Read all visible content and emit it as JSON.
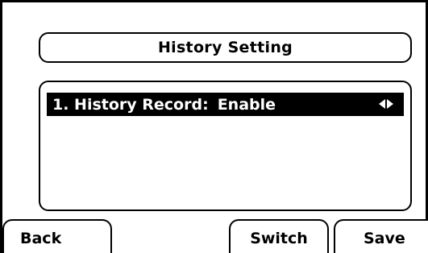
{
  "title": "History Setting",
  "list": {
    "items": [
      {
        "label": "1. History Record:",
        "value": "Enable"
      }
    ]
  },
  "softkeys": {
    "back": "Back",
    "switch": "Switch",
    "save": "Save"
  },
  "colors": {
    "background": "#ffffff",
    "foreground": "#000000",
    "highlight": "#000000",
    "highlight_text": "#ffffff"
  },
  "icons": {
    "value_arrows": "left-right-arrows-icon"
  }
}
